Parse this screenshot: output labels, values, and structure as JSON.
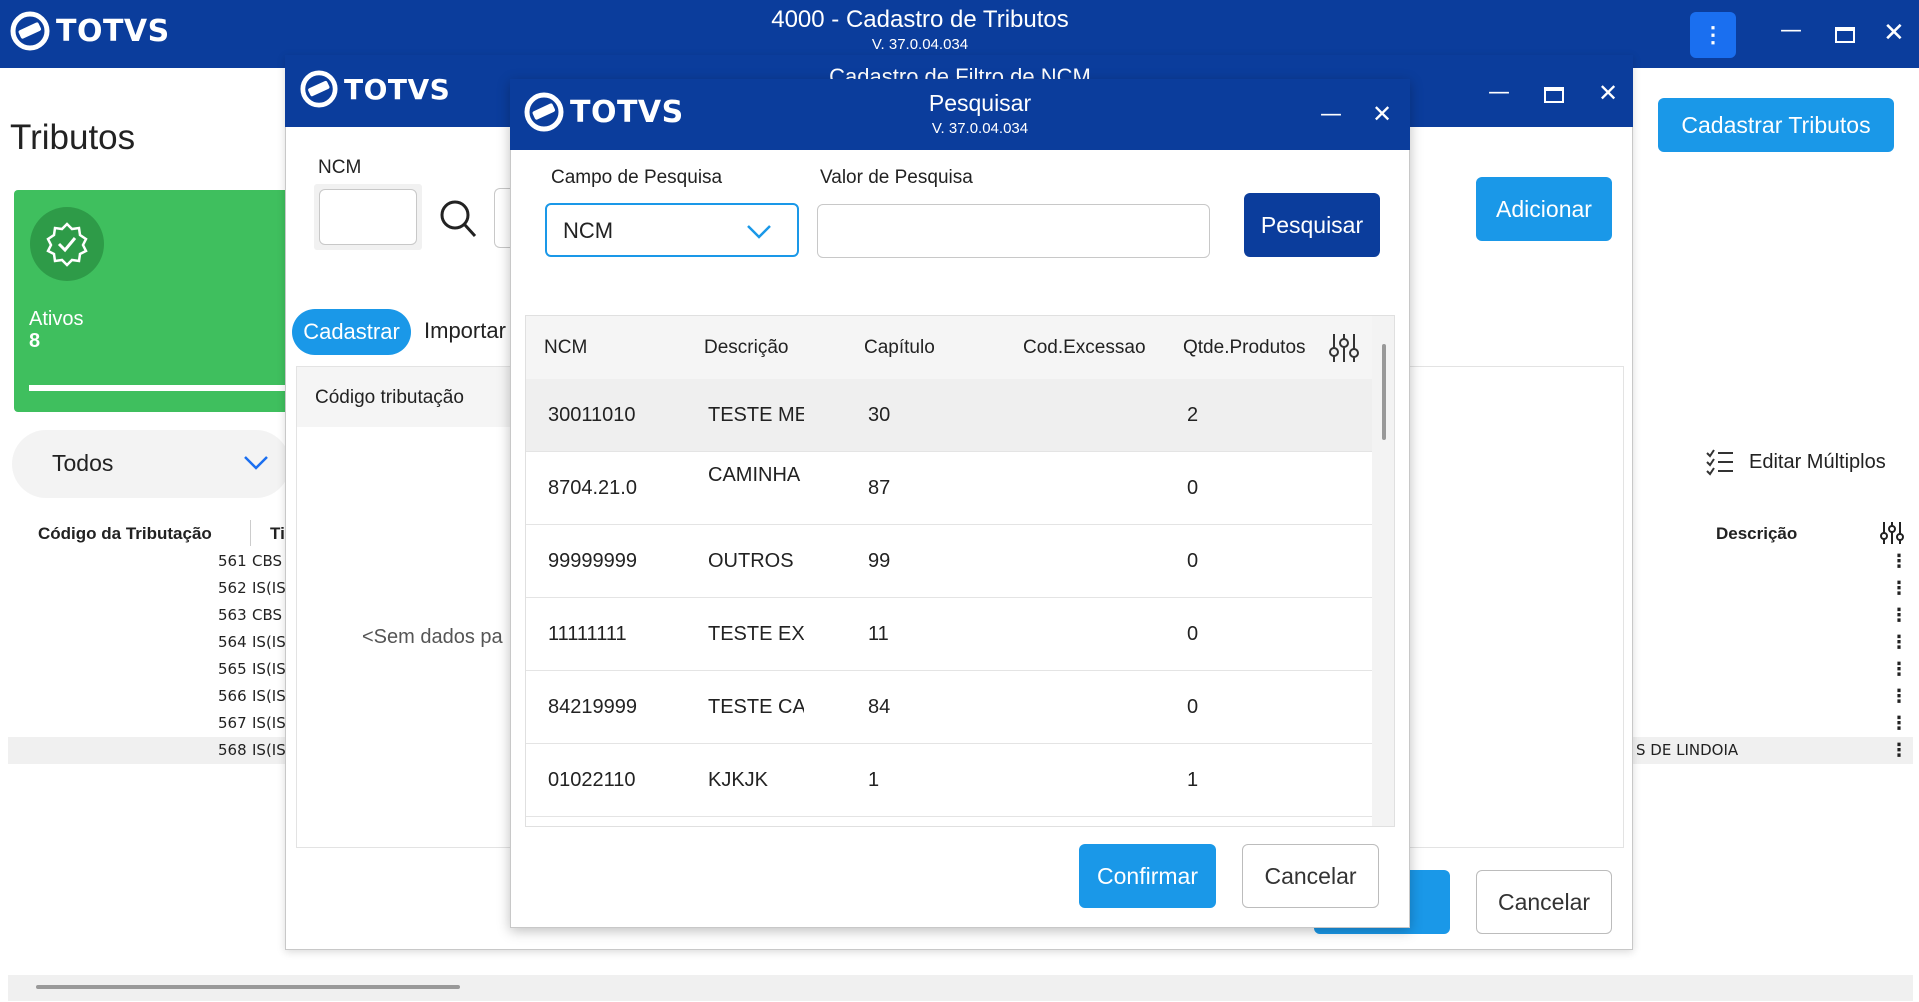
{
  "main_window": {
    "app_name": "TOTVS",
    "title": "4000 - Cadastro de Tributos",
    "version": "V. 37.0.04.034"
  },
  "main_page": {
    "heading": "Tributos",
    "register_button": "Cadastrar Tributos",
    "card": {
      "label": "Ativos",
      "value": "8"
    },
    "filter_select": "Todos",
    "edit_multiple": "Editar Múltiplos",
    "grid": {
      "col_code": "Código da Tributação",
      "col_type": "Ti",
      "col_desc": "Descrição",
      "rows": [
        {
          "code": "561",
          "type": "CBS",
          "desc": ""
        },
        {
          "code": "562",
          "type": "IS(IS",
          "desc": ""
        },
        {
          "code": "563",
          "type": "CBS",
          "desc": ""
        },
        {
          "code": "564",
          "type": "IS(IS",
          "desc": ""
        },
        {
          "code": "565",
          "type": "IS(IS",
          "desc": ""
        },
        {
          "code": "566",
          "type": "IS(IS",
          "desc": ""
        },
        {
          "code": "567",
          "type": "IS(IS",
          "desc": ""
        },
        {
          "code": "568",
          "type": "IS(IS",
          "desc": "S DE LINDOIA"
        }
      ]
    }
  },
  "ncm_window": {
    "app_name": "TOTVS",
    "title": "Cadastro de Filtro de NCM",
    "ncm_label": "NCM",
    "tabs": [
      "Cadastrar",
      "Importar"
    ],
    "col_code": "Código tributação",
    "empty_text": "<Sem dados pa",
    "add_button": "Adicionar",
    "cancel_button": "Cancelar"
  },
  "search_dialog": {
    "app_name": "TOTVS",
    "title": "Pesquisar",
    "version": "V. 37.0.04.034",
    "field_label": "Campo de Pesquisa",
    "field_value": "NCM",
    "value_label": "Valor de Pesquisa",
    "value_input": "",
    "search_button": "Pesquisar",
    "columns": [
      "NCM",
      "Descrição",
      "Capítulo",
      "Cod.Excessao",
      "Qtde.Produtos"
    ],
    "rows": [
      {
        "ncm": "30011010",
        "desc": "TESTE ME",
        "cap": "30",
        "exc": "",
        "qty": "2"
      },
      {
        "ncm": "8704.21.0",
        "desc": "CAMINHA",
        "cap": "87",
        "exc": "",
        "qty": "0"
      },
      {
        "ncm": "99999999",
        "desc": "OUTROS",
        "cap": "99",
        "exc": "",
        "qty": "0"
      },
      {
        "ncm": "11111111",
        "desc": "TESTE EXC",
        "cap": "11",
        "exc": "",
        "qty": "0"
      },
      {
        "ncm": "84219999",
        "desc": "TESTE CAI",
        "cap": "84",
        "exc": "",
        "qty": "0"
      },
      {
        "ncm": "01022110",
        "desc": "KJKJK",
        "cap": "1",
        "exc": "",
        "qty": "1"
      }
    ],
    "confirm_button": "Confirmar",
    "cancel_button": "Cancelar"
  },
  "colors": {
    "titlebar": "#0b3d9c",
    "accent_blue": "#1a98e8",
    "card_green": "#3fbf5e"
  }
}
